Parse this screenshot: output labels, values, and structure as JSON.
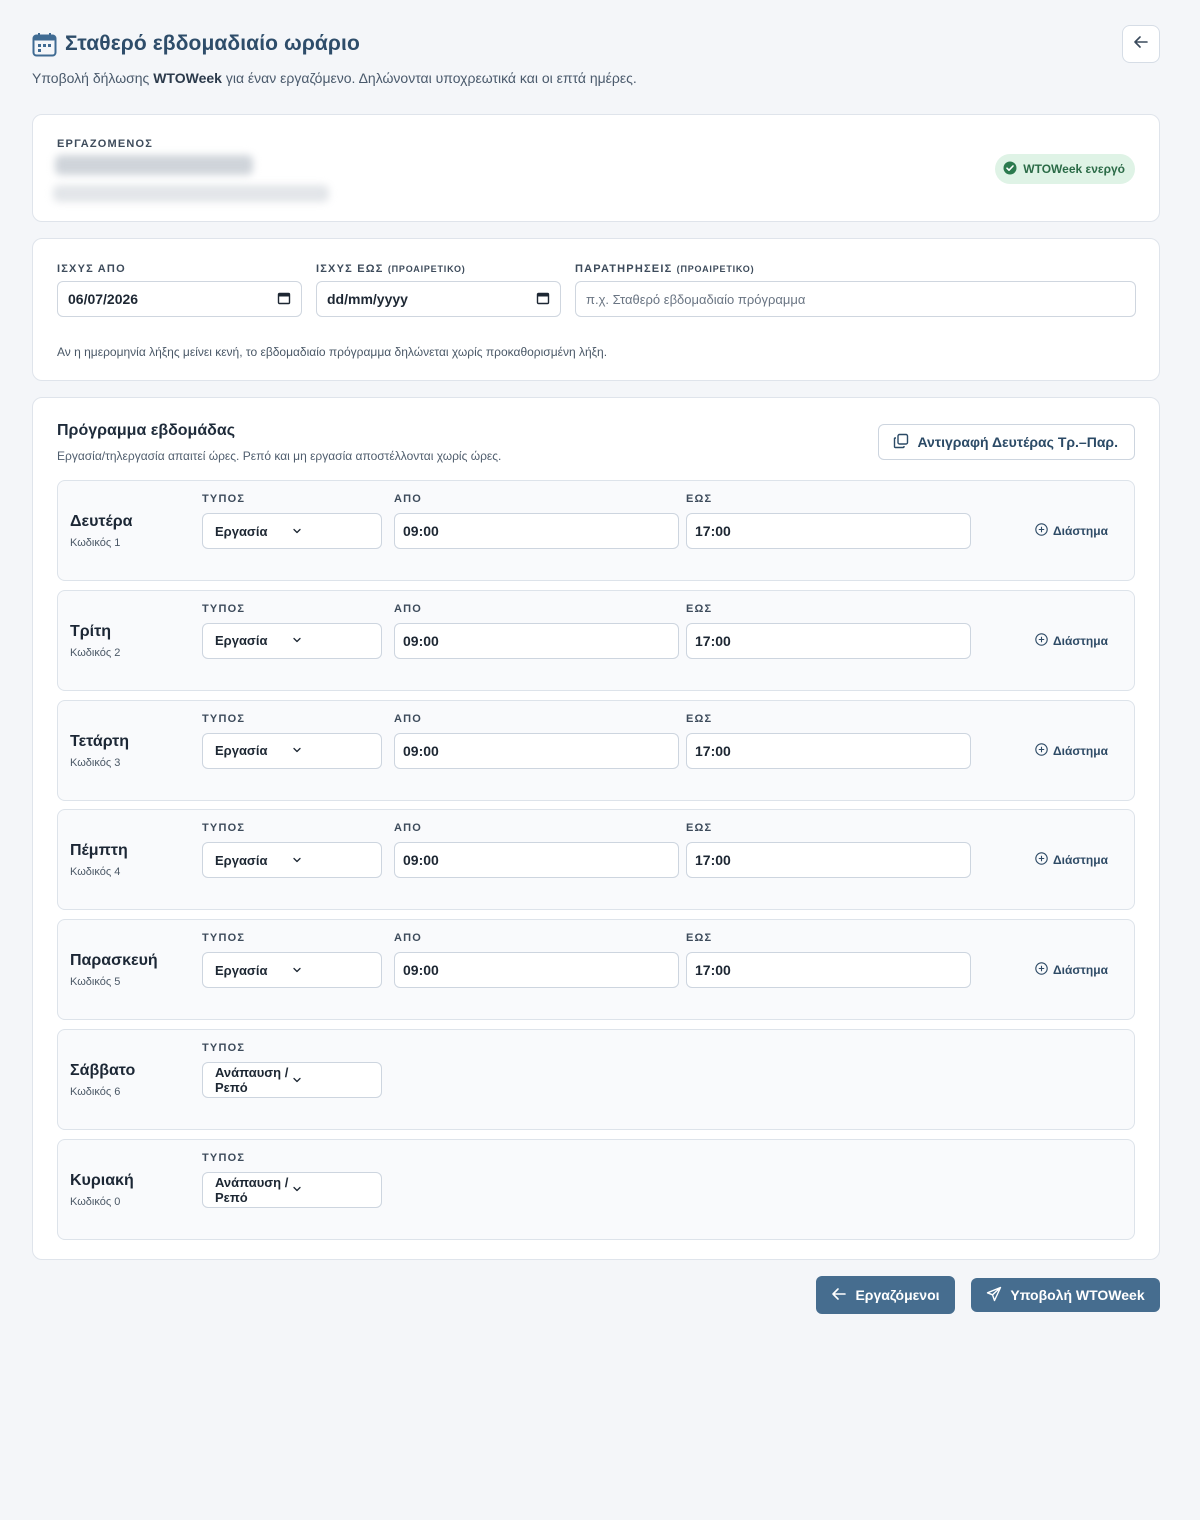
{
  "header": {
    "title": "Σταθερό εβδομαδιαίο ωράριο",
    "subtitle_pre": "Υποβολή δήλωσης ",
    "subtitle_bold": "WTOWeek",
    "subtitle_post": " για έναν εργαζόμενο. Δηλώνονται υποχρεωτικά και οι επτά ημέρες."
  },
  "employee": {
    "label": "ΕΡΓΑΖΟΜΕΝΟΣ",
    "badge": "WTOWeek ενεργό"
  },
  "validity": {
    "from_label": "ΙΣΧΥΣ ΑΠΟ",
    "from_value": "06/07/2026",
    "to_label": "ΙΣΧΥΣ ΕΩΣ",
    "to_optional": "(ΠΡΟΑΙΡΕΤΙΚΟ)",
    "to_placeholder": "dd/mm/yyyy",
    "notes_label": "ΠΑΡΑΤΗΡΗΣΕΙΣ",
    "notes_optional": "(ΠΡΟΑΙΡΕΤΙΚΟ)",
    "notes_placeholder": "π.χ. Σταθερό εβδομαδιαίο πρόγραμμα",
    "hint": "Αν η ημερομηνία λήξης μείνει κενή, το εβδομαδιαίο πρόγραμμα δηλώνεται χωρίς προκαθορισμένη λήξη."
  },
  "schedule": {
    "title": "Πρόγραμμα εβδομάδας",
    "subtitle": "Εργασία/τηλεργασία απαιτεί ώρες. Ρεπό και μη εργασία αποστέλλονται χωρίς ώρες.",
    "copy_button": "Αντιγραφή Δευτέρας Τρ.–Παρ.",
    "type_label": "ΤΥΠΟΣ",
    "from_label": "ΑΠΟ",
    "to_label": "ΕΩΣ",
    "interval_label": "Διάστημα",
    "days": [
      {
        "name": "Δευτέρα",
        "code": "Κωδικός 1",
        "type": "Εργασία",
        "from": "09:00",
        "to": "17:00"
      },
      {
        "name": "Τρίτη",
        "code": "Κωδικός 2",
        "type": "Εργασία",
        "from": "09:00",
        "to": "17:00"
      },
      {
        "name": "Τετάρτη",
        "code": "Κωδικός 3",
        "type": "Εργασία",
        "from": "09:00",
        "to": "17:00"
      },
      {
        "name": "Πέμπτη",
        "code": "Κωδικός 4",
        "type": "Εργασία",
        "from": "09:00",
        "to": "17:00"
      },
      {
        "name": "Παρασκευή",
        "code": "Κωδικός 5",
        "type": "Εργασία",
        "from": "09:00",
        "to": "17:00"
      },
      {
        "name": "Σάββατο",
        "code": "Κωδικός 6",
        "type": "Ανάπαυση / Ρεπό"
      },
      {
        "name": "Κυριακή",
        "code": "Κωδικός 0",
        "type": "Ανάπαυση / Ρεπό"
      }
    ]
  },
  "footer": {
    "employees_button": "Εργαζόμενοι",
    "submit_button": "Υποβολή WTOWeek"
  },
  "colors": {
    "primary": "#466d8f",
    "title": "#2e4d6a",
    "badge_bg": "#dff3e6",
    "badge_text": "#2b6b47"
  }
}
